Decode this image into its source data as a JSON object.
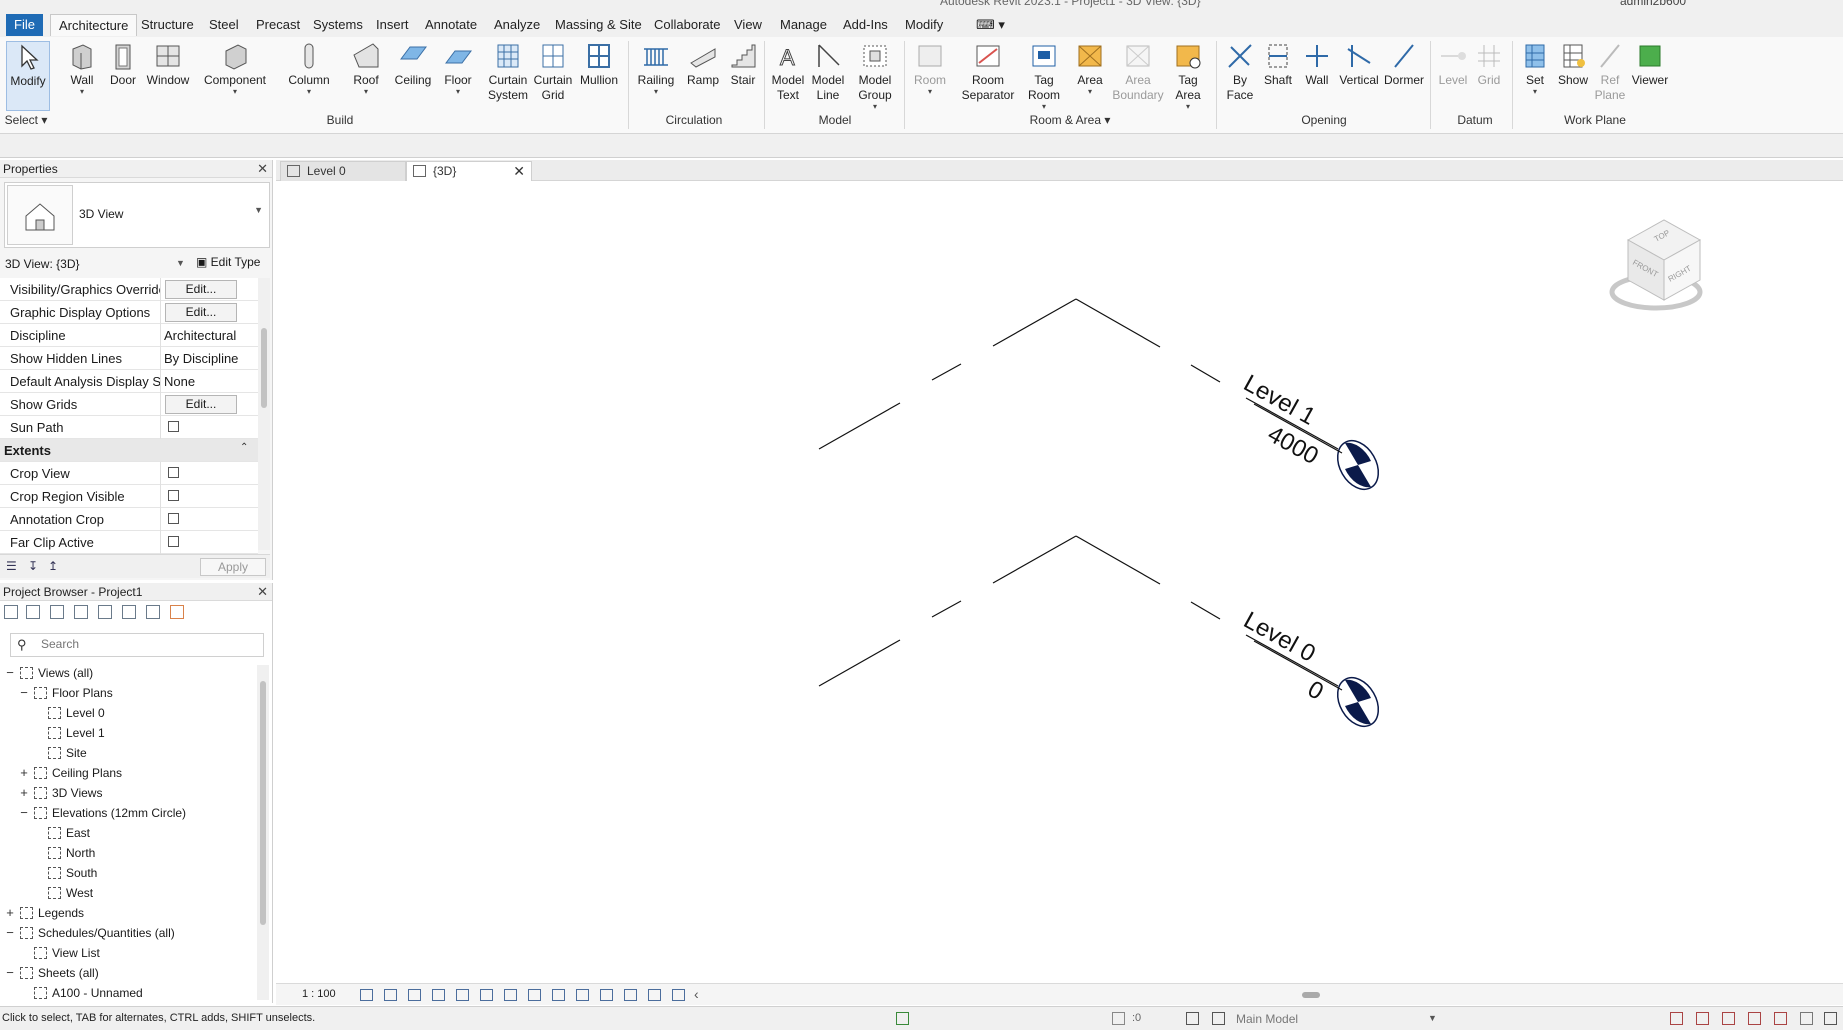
{
  "window": {
    "title": "Autodesk Revit 2023.1 - Project1 - 3D View: {3D}",
    "user": "admin2b600"
  },
  "menu": {
    "tabs": [
      "File",
      "Architecture",
      "Structure",
      "Steel",
      "Precast",
      "Systems",
      "Insert",
      "Annotate",
      "Analyze",
      "Massing & Site",
      "Collaborate",
      "View",
      "Manage",
      "Add-Ins",
      "Modify"
    ],
    "active": "Architecture"
  },
  "ribbon": {
    "buttons": [
      {
        "id": "modify",
        "label": "Modify"
      },
      {
        "id": "wall",
        "label": "Wall"
      },
      {
        "id": "door",
        "label": "Door"
      },
      {
        "id": "window",
        "label": "Window"
      },
      {
        "id": "component",
        "label": "Component"
      },
      {
        "id": "column",
        "label": "Column"
      },
      {
        "id": "roof",
        "label": "Roof"
      },
      {
        "id": "ceiling",
        "label": "Ceiling"
      },
      {
        "id": "floor",
        "label": "Floor"
      },
      {
        "id": "curtain-system",
        "label": "Curtain System"
      },
      {
        "id": "curtain-grid",
        "label": "Curtain Grid"
      },
      {
        "id": "mullion",
        "label": "Mullion"
      },
      {
        "id": "railing",
        "label": "Railing"
      },
      {
        "id": "ramp",
        "label": "Ramp"
      },
      {
        "id": "stair",
        "label": "Stair"
      },
      {
        "id": "model-text",
        "label": "Model Text"
      },
      {
        "id": "model-line",
        "label": "Model Line"
      },
      {
        "id": "model-group",
        "label": "Model Group"
      },
      {
        "id": "room",
        "label": "Room"
      },
      {
        "id": "room-separator",
        "label": "Room Separator"
      },
      {
        "id": "tag-room",
        "label": "Tag Room"
      },
      {
        "id": "area",
        "label": "Area"
      },
      {
        "id": "area-boundary",
        "label": "Area Boundary"
      },
      {
        "id": "tag-area",
        "label": "Tag Area"
      },
      {
        "id": "by-face",
        "label": "By Face"
      },
      {
        "id": "shaft",
        "label": "Shaft"
      },
      {
        "id": "wall-opening",
        "label": "Wall"
      },
      {
        "id": "vertical",
        "label": "Vertical"
      },
      {
        "id": "dormer",
        "label": "Dormer"
      },
      {
        "id": "level",
        "label": "Level"
      },
      {
        "id": "grid",
        "label": "Grid"
      },
      {
        "id": "set",
        "label": "Set"
      },
      {
        "id": "show",
        "label": "Show"
      },
      {
        "id": "ref-plane",
        "label": "Ref Plane"
      },
      {
        "id": "viewer",
        "label": "Viewer"
      }
    ],
    "groups": [
      "Select",
      "Build",
      "Circulation",
      "Model",
      "Room & Area",
      "Opening",
      "Datum",
      "Work Plane"
    ]
  },
  "properties": {
    "title": "Properties",
    "type_name": "3D View",
    "instance": "3D View: {3D}",
    "edit_type": "Edit Type",
    "rows": [
      {
        "key": "Visibility/Graphics Overrides",
        "kind": "button",
        "value": "Edit..."
      },
      {
        "key": "Graphic Display Options",
        "kind": "button",
        "value": "Edit..."
      },
      {
        "key": "Discipline",
        "kind": "text",
        "value": "Architectural"
      },
      {
        "key": "Show Hidden Lines",
        "kind": "text",
        "value": "By Discipline"
      },
      {
        "key": "Default Analysis Display Style",
        "kind": "text",
        "value": "None"
      },
      {
        "key": "Show Grids",
        "kind": "button",
        "value": "Edit..."
      },
      {
        "key": "Sun Path",
        "kind": "checkbox",
        "value": ""
      },
      {
        "key": "Extents",
        "kind": "section",
        "value": ""
      },
      {
        "key": "Crop View",
        "kind": "checkbox",
        "value": ""
      },
      {
        "key": "Crop Region Visible",
        "kind": "checkbox",
        "value": ""
      },
      {
        "key": "Annotation Crop",
        "kind": "checkbox",
        "value": ""
      },
      {
        "key": "Far Clip Active",
        "kind": "checkbox",
        "value": ""
      }
    ],
    "apply": "Apply"
  },
  "browser": {
    "title": "Project Browser - Project1",
    "search_placeholder": "Search",
    "tree": [
      {
        "label": "Views (all)",
        "level": 0,
        "exp": "−"
      },
      {
        "label": "Floor Plans",
        "level": 1,
        "exp": "−"
      },
      {
        "label": "Level 0",
        "level": 2,
        "exp": ""
      },
      {
        "label": "Level 1",
        "level": 2,
        "exp": ""
      },
      {
        "label": "Site",
        "level": 2,
        "exp": ""
      },
      {
        "label": "Ceiling Plans",
        "level": 1,
        "exp": "+"
      },
      {
        "label": "3D Views",
        "level": 1,
        "exp": "+"
      },
      {
        "label": "Elevations (12mm Circle)",
        "level": 1,
        "exp": "−"
      },
      {
        "label": "East",
        "level": 2,
        "exp": ""
      },
      {
        "label": "North",
        "level": 2,
        "exp": ""
      },
      {
        "label": "South",
        "level": 2,
        "exp": ""
      },
      {
        "label": "West",
        "level": 2,
        "exp": ""
      },
      {
        "label": "Legends",
        "level": 0,
        "exp": "+"
      },
      {
        "label": "Schedules/Quantities (all)",
        "level": 0,
        "exp": "−"
      },
      {
        "label": "View List",
        "level": 1,
        "exp": ""
      },
      {
        "label": "Sheets (all)",
        "level": 0,
        "exp": "−"
      },
      {
        "label": "A100 - Unnamed",
        "level": 1,
        "exp": ""
      }
    ]
  },
  "viewtabs": [
    {
      "label": "Level 0",
      "active": false
    },
    {
      "label": "{3D}",
      "active": true
    }
  ],
  "canvas": {
    "levels": [
      {
        "name": "Level 1",
        "elevation": "4000"
      },
      {
        "name": "Level 0",
        "elevation": "0"
      }
    ],
    "viewcube": {
      "top": "TOP",
      "front": "FRONT",
      "right": "RIGHT"
    }
  },
  "viewbar": {
    "scale": "1 : 100"
  },
  "status": {
    "message": "Click to select, TAB for alternates, CTRL adds, SHIFT unselects.",
    "selection_count": ":0",
    "active_model": "Main Model"
  },
  "colors": {
    "accent": "#1f6bb5",
    "level_head": "#0b1a4a"
  }
}
